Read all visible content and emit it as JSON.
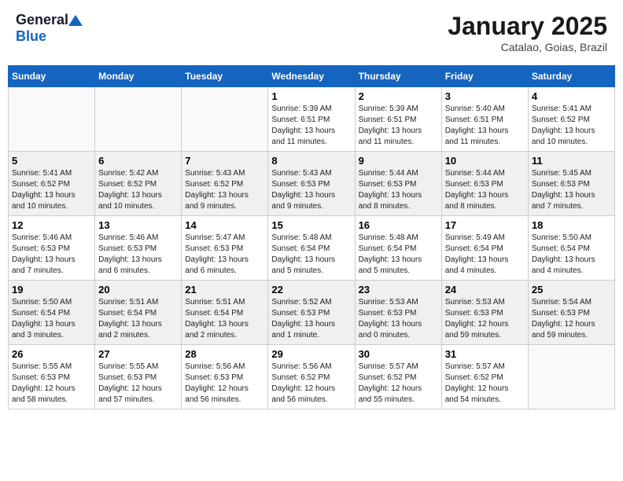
{
  "logo": {
    "general": "General",
    "blue": "Blue"
  },
  "title": "January 2025",
  "location": "Catalao, Goias, Brazil",
  "weekdays": [
    "Sunday",
    "Monday",
    "Tuesday",
    "Wednesday",
    "Thursday",
    "Friday",
    "Saturday"
  ],
  "weeks": [
    [
      {
        "day": "",
        "info": ""
      },
      {
        "day": "",
        "info": ""
      },
      {
        "day": "",
        "info": ""
      },
      {
        "day": "1",
        "info": "Sunrise: 5:39 AM\nSunset: 6:51 PM\nDaylight: 13 hours\nand 11 minutes."
      },
      {
        "day": "2",
        "info": "Sunrise: 5:39 AM\nSunset: 6:51 PM\nDaylight: 13 hours\nand 11 minutes."
      },
      {
        "day": "3",
        "info": "Sunrise: 5:40 AM\nSunset: 6:51 PM\nDaylight: 13 hours\nand 11 minutes."
      },
      {
        "day": "4",
        "info": "Sunrise: 5:41 AM\nSunset: 6:52 PM\nDaylight: 13 hours\nand 10 minutes."
      }
    ],
    [
      {
        "day": "5",
        "info": "Sunrise: 5:41 AM\nSunset: 6:52 PM\nDaylight: 13 hours\nand 10 minutes."
      },
      {
        "day": "6",
        "info": "Sunrise: 5:42 AM\nSunset: 6:52 PM\nDaylight: 13 hours\nand 10 minutes."
      },
      {
        "day": "7",
        "info": "Sunrise: 5:43 AM\nSunset: 6:52 PM\nDaylight: 13 hours\nand 9 minutes."
      },
      {
        "day": "8",
        "info": "Sunrise: 5:43 AM\nSunset: 6:53 PM\nDaylight: 13 hours\nand 9 minutes."
      },
      {
        "day": "9",
        "info": "Sunrise: 5:44 AM\nSunset: 6:53 PM\nDaylight: 13 hours\nand 8 minutes."
      },
      {
        "day": "10",
        "info": "Sunrise: 5:44 AM\nSunset: 6:53 PM\nDaylight: 13 hours\nand 8 minutes."
      },
      {
        "day": "11",
        "info": "Sunrise: 5:45 AM\nSunset: 6:53 PM\nDaylight: 13 hours\nand 7 minutes."
      }
    ],
    [
      {
        "day": "12",
        "info": "Sunrise: 5:46 AM\nSunset: 6:53 PM\nDaylight: 13 hours\nand 7 minutes."
      },
      {
        "day": "13",
        "info": "Sunrise: 5:46 AM\nSunset: 6:53 PM\nDaylight: 13 hours\nand 6 minutes."
      },
      {
        "day": "14",
        "info": "Sunrise: 5:47 AM\nSunset: 6:53 PM\nDaylight: 13 hours\nand 6 minutes."
      },
      {
        "day": "15",
        "info": "Sunrise: 5:48 AM\nSunset: 6:54 PM\nDaylight: 13 hours\nand 5 minutes."
      },
      {
        "day": "16",
        "info": "Sunrise: 5:48 AM\nSunset: 6:54 PM\nDaylight: 13 hours\nand 5 minutes."
      },
      {
        "day": "17",
        "info": "Sunrise: 5:49 AM\nSunset: 6:54 PM\nDaylight: 13 hours\nand 4 minutes."
      },
      {
        "day": "18",
        "info": "Sunrise: 5:50 AM\nSunset: 6:54 PM\nDaylight: 13 hours\nand 4 minutes."
      }
    ],
    [
      {
        "day": "19",
        "info": "Sunrise: 5:50 AM\nSunset: 6:54 PM\nDaylight: 13 hours\nand 3 minutes."
      },
      {
        "day": "20",
        "info": "Sunrise: 5:51 AM\nSunset: 6:54 PM\nDaylight: 13 hours\nand 2 minutes."
      },
      {
        "day": "21",
        "info": "Sunrise: 5:51 AM\nSunset: 6:54 PM\nDaylight: 13 hours\nand 2 minutes."
      },
      {
        "day": "22",
        "info": "Sunrise: 5:52 AM\nSunset: 6:53 PM\nDaylight: 13 hours\nand 1 minute."
      },
      {
        "day": "23",
        "info": "Sunrise: 5:53 AM\nSunset: 6:53 PM\nDaylight: 13 hours\nand 0 minutes."
      },
      {
        "day": "24",
        "info": "Sunrise: 5:53 AM\nSunset: 6:53 PM\nDaylight: 12 hours\nand 59 minutes."
      },
      {
        "day": "25",
        "info": "Sunrise: 5:54 AM\nSunset: 6:53 PM\nDaylight: 12 hours\nand 59 minutes."
      }
    ],
    [
      {
        "day": "26",
        "info": "Sunrise: 5:55 AM\nSunset: 6:53 PM\nDaylight: 12 hours\nand 58 minutes."
      },
      {
        "day": "27",
        "info": "Sunrise: 5:55 AM\nSunset: 6:53 PM\nDaylight: 12 hours\nand 57 minutes."
      },
      {
        "day": "28",
        "info": "Sunrise: 5:56 AM\nSunset: 6:53 PM\nDaylight: 12 hours\nand 56 minutes."
      },
      {
        "day": "29",
        "info": "Sunrise: 5:56 AM\nSunset: 6:52 PM\nDaylight: 12 hours\nand 56 minutes."
      },
      {
        "day": "30",
        "info": "Sunrise: 5:57 AM\nSunset: 6:52 PM\nDaylight: 12 hours\nand 55 minutes."
      },
      {
        "day": "31",
        "info": "Sunrise: 5:57 AM\nSunset: 6:52 PM\nDaylight: 12 hours\nand 54 minutes."
      },
      {
        "day": "",
        "info": ""
      }
    ]
  ]
}
